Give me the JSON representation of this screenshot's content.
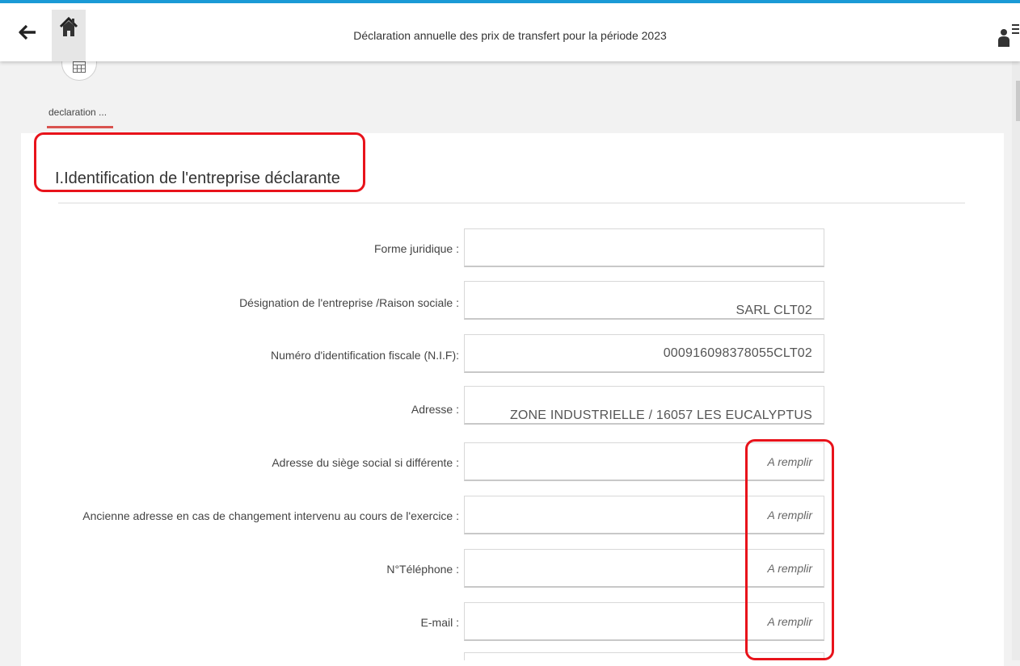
{
  "header": {
    "title": "Déclaration annuelle des prix de transfert pour la période 2023",
    "back_icon": "arrow-left-icon",
    "home_icon": "home-icon",
    "user_icon": "user-menu-icon",
    "accent_color": "#1a9ad6"
  },
  "stepper": {
    "step_label": "declaration ...",
    "step_icon": "table-icon",
    "active_color": "#d9534f"
  },
  "section": {
    "title": "I.Identification de l'entreprise déclarante"
  },
  "form": {
    "rows": [
      {
        "label": "Forme juridique :",
        "value": "",
        "placeholder": ""
      },
      {
        "label": "Désignation de l'entreprise /Raison sociale :",
        "value": "SARL CLT02",
        "placeholder": ""
      },
      {
        "label": "Numéro d'identification fiscale (N.I.F):",
        "value": "000916098378055CLT02",
        "placeholder": ""
      },
      {
        "label": "Adresse :",
        "value": "ZONE INDUSTRIELLE / 16057 LES EUCALYPTUS",
        "placeholder": ""
      },
      {
        "label": "Adresse du siège social si différente :",
        "value": "",
        "placeholder": "A remplir"
      },
      {
        "label": "Ancienne adresse en cas de changement intervenu au cours de l'exercice :",
        "value": "",
        "placeholder": "A remplir"
      },
      {
        "label": "N°Téléphone :",
        "value": "",
        "placeholder": "A remplir"
      },
      {
        "label": "E-mail :",
        "value": "",
        "placeholder": "A remplir"
      }
    ]
  },
  "annotations": {
    "color": "#e8131b"
  }
}
